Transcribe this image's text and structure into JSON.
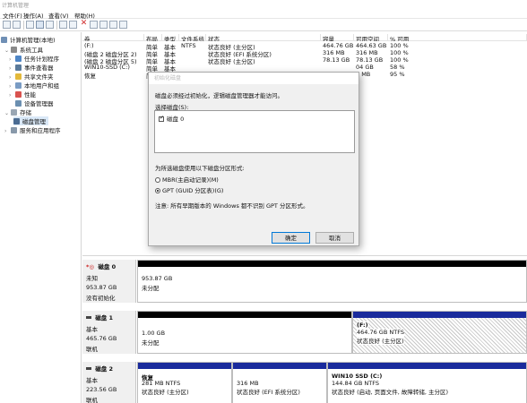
{
  "window": {
    "title": "计算机管理"
  },
  "menu": [
    "文件(F)",
    "操作(A)",
    "查看(V)",
    "帮助(H)"
  ],
  "toolbar": {
    "icons": [
      "back-icon",
      "forward-icon",
      "up-icon",
      "console-tree-icon",
      "properties-icon",
      "help-icon",
      "delete-icon",
      "new-icon",
      "open-icon",
      "save-icon",
      "refresh-icon"
    ]
  },
  "tree": {
    "root": "计算机管理(本地)",
    "items": [
      {
        "label": "系统工具",
        "icon": "tools-icon"
      },
      {
        "label": "任务计划程序",
        "icon": "clock-icon"
      },
      {
        "label": "事件查看器",
        "icon": "event-icon"
      },
      {
        "label": "共享文件夹",
        "icon": "folder-icon"
      },
      {
        "label": "本地用户和组",
        "icon": "users-icon"
      },
      {
        "label": "性能",
        "icon": "performance-icon"
      },
      {
        "label": "设备管理器",
        "icon": "device-icon"
      },
      {
        "label": "存储",
        "icon": "storage-icon"
      },
      {
        "label": "磁盘管理",
        "icon": "disk-icon"
      },
      {
        "label": "服务和应用程序",
        "icon": "services-icon"
      }
    ]
  },
  "volume_table": {
    "columns": [
      "卷",
      "布局",
      "类型",
      "文件系统",
      "状态",
      "容量",
      "可用空间",
      "% 可用"
    ],
    "rows": [
      [
        "(F:)",
        "简单",
        "基本",
        "NTFS",
        "状态良好 (主分区)",
        "464.76 GB",
        "464.63 GB",
        "100 %"
      ],
      [
        "(磁盘 2 磁盘分区 2)",
        "简单",
        "基本",
        "",
        "状态良好 (EFI 系统分区)",
        "316 MB",
        "316 MB",
        "100 %"
      ],
      [
        "(磁盘 2 磁盘分区 5)",
        "简单",
        "基本",
        "",
        "状态良好 (主分区)",
        "78.13 GB",
        "78.13 GB",
        "100 %"
      ],
      [
        "WIN10-SSD (C:)",
        "简单",
        "基本",
        "",
        "",
        "",
        "04 GB",
        "58 %"
      ],
      [
        "恢复",
        "简单",
        "基本",
        "",
        "",
        "",
        "7 MB",
        "95 %"
      ]
    ]
  },
  "dialog": {
    "title": "初始化磁盘",
    "message": "磁盘必须经过初始化，逻辑磁盘管理器才能访问。",
    "select_label": "选择磁盘(S):",
    "disks": [
      {
        "label": "磁盘 0",
        "checked": true
      }
    ],
    "style_label": "为所选磁盘使用以下磁盘分区形式:",
    "options": [
      {
        "label": "MBR(主启动记录)(M)",
        "selected": false
      },
      {
        "label": "GPT (GUID 分区表)(G)",
        "selected": true
      }
    ],
    "note": "注意: 所有早期版本的 Windows 都不识别 GPT 分区形式。",
    "ok": "确定",
    "cancel": "取消"
  },
  "disks": [
    {
      "name": "磁盘 0",
      "type": "未知",
      "size": "953.87 GB",
      "status": "没有初始化",
      "icon": "warning-icon",
      "partitions": [
        {
          "size": "953.87 GB",
          "status": "未分配",
          "bar": "#000000"
        }
      ]
    },
    {
      "name": "磁盘 1",
      "type": "基本",
      "size": "465.76 GB",
      "status": "联机",
      "icon": "disk-icon",
      "partitions": [
        {
          "size": "1.00 GB",
          "status": "未分配",
          "bar": "#000000"
        },
        {
          "name": "(F:)",
          "size": "464.76 GB NTFS",
          "status": "状态良好 (主分区)",
          "bar": "#1a2b9c"
        }
      ]
    },
    {
      "name": "磁盘 2",
      "type": "基本",
      "size": "223.56 GB",
      "status": "联机",
      "icon": "disk-icon",
      "partitions": [
        {
          "name": "恢复",
          "size": "281 MB NTFS",
          "status": "状态良好 (主分区)",
          "bar": "#1a2b9c"
        },
        {
          "size": "316 MB",
          "status": "状态良好 (EFI 系统分区)",
          "bar": "#1a2b9c"
        },
        {
          "name": "WIN10 SSD  (C:)",
          "size": "144.84 GB NTFS",
          "status": "状态良好 (启动, 页面文件, 故障转储, 主分区)",
          "bar": "#1a2b9c"
        }
      ]
    }
  ]
}
